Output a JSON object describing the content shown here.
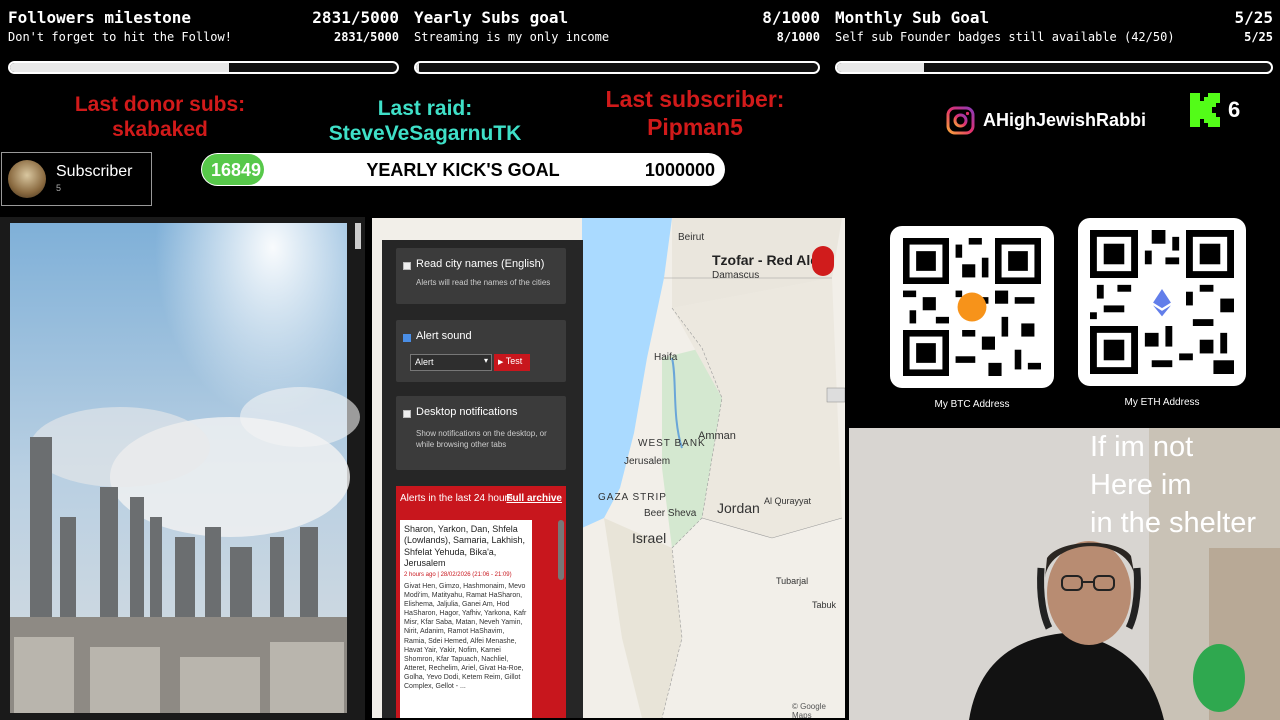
{
  "goals": [
    {
      "title": "Followers milestone",
      "title_value": "2831/5000",
      "subtitle": "Don't forget to hit the Follow!",
      "subtitle_value": "2831/5000",
      "progress": 0.566
    },
    {
      "title": "Yearly Subs goal",
      "title_value": "8/1000",
      "subtitle": "Streaming is my only income",
      "subtitle_value": "8/1000",
      "progress": 0.008
    },
    {
      "title": "Monthly Sub Goal",
      "title_value": "5/25",
      "subtitle": "Self sub Founder badges still available (42/50)",
      "subtitle_value": "5/25",
      "progress": 0.2
    }
  ],
  "last_donor": {
    "label": "Last donor subs:",
    "name": "skabaked"
  },
  "last_raid": {
    "label": "Last raid:",
    "name": "SteveVeSagarnuTK"
  },
  "last_subscriber": {
    "label": "Last subscriber:",
    "name": "Pipman5"
  },
  "instagram": {
    "handle": "AHighJewishRabbi"
  },
  "kick_count": "6",
  "sub_card": {
    "label": "Subscriber",
    "count": "5"
  },
  "kick_goal": {
    "current": "16849",
    "label": "YEARLY KICK'S GOAL",
    "target": "1000000",
    "progress": 0.0168
  },
  "btc_label": "My BTC Address",
  "eth_label": "My ETH Address",
  "shelter": {
    "line1": "If im not",
    "line2": "Here im",
    "line3": "in the shelter"
  },
  "red_alert": {
    "read_names_title": "Read city names (English)",
    "read_names_desc": "Alerts will read the names of the cities",
    "sound_title": "Alert sound",
    "sound_select": "Alert",
    "test_label": "Test",
    "desktop_title": "Desktop notifications",
    "desktop_desc": "Show notifications on the desktop, or while browsing other tabs",
    "alerts_header": "Alerts in the last 24 hours",
    "archive_label": "Full archive",
    "alert_regions": "Sharon, Yarkon, Dan, Shfela (Lowlands), Samaria, Lakhish, Shfelat Yehuda, Bika'a, Jerusalem",
    "alert_time": "2 hours ago | 28/02/2026 (21:06 - 21:09)",
    "alert_cities": "Givat Hen, Gimzo, Hashmonaim, Mevo Modi'im, Matityahu, Ramat HaSharon, Elishema, Jaljulia, Ganei Am, Hod HaSharon, Hagor, Yafhiv, Yarkona, Kafr Misr, Kfar Saba, Matan, Neveh Yamin, Nirit, Adanim, Ramot HaShavim, Ramia, Sdei Hemed, Alfei Menashe, Havat Yair, Yakir, Nofim, Karnei Shomron, Kfar Tapuach, Nachliel, Atteret, Rechelim, Ariel, Givat Ha-Roe, Golha, Yevo Dodi, Ketem Reim, Gillot Complex, Gellot - ..."
  },
  "map": {
    "brand": "Tzofar - Red Alert",
    "labels": [
      "Beirut",
      "Damascus",
      "Haifa",
      "WEST BANK",
      "Amman",
      "Jerusalem",
      "GAZA STRIP",
      "Beer Sheva",
      "Israel",
      "Jordan",
      "Al Qurayyat",
      "Tubarjal",
      "Tabuk"
    ],
    "attribution": "© Google Maps"
  }
}
